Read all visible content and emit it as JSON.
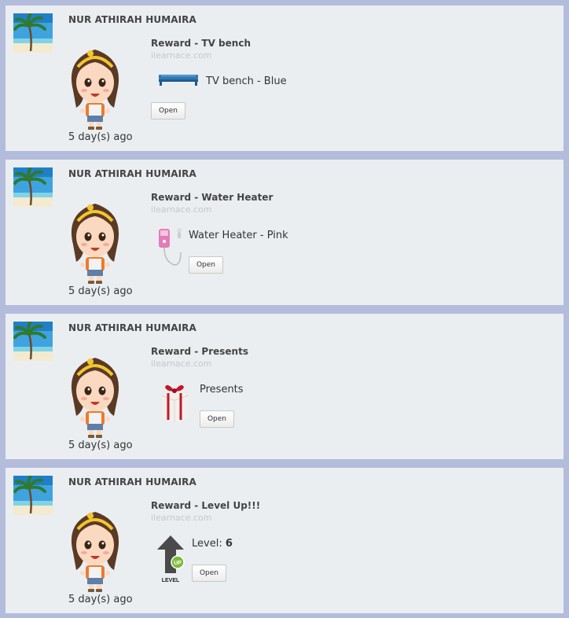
{
  "feed": [
    {
      "user_name": "NUR ATHIRAH HUMAIRA",
      "reward_title": "Reward - TV bench",
      "site": "ilearnace.com",
      "item_label": "TV bench - Blue",
      "item_icon": "tv-bench-icon",
      "open_label": "Open",
      "time_ago": "5 day(s) ago"
    },
    {
      "user_name": "NUR ATHIRAH HUMAIRA",
      "reward_title": "Reward - Water Heater",
      "site": "ilearnace.com",
      "item_label": "Water Heater - Pink",
      "item_icon": "water-heater-icon",
      "open_label": "Open",
      "time_ago": "5 day(s) ago"
    },
    {
      "user_name": "NUR ATHIRAH HUMAIRA",
      "reward_title": "Reward - Presents",
      "site": "ilearnace.com",
      "item_label": "Presents",
      "item_icon": "gift-box-icon",
      "open_label": "Open",
      "time_ago": "5 day(s) ago"
    },
    {
      "user_name": "NUR ATHIRAH HUMAIRA",
      "reward_title": "Reward - Level Up!!!",
      "site": "ilearnace.com",
      "item_label_prefix": "Level:",
      "item_label_value": "6",
      "item_icon": "level-up-icon",
      "level_icon_text": "LEVEL",
      "level_badge_text": "UP",
      "open_label": "Open",
      "time_ago": "5 day(s) ago"
    }
  ],
  "colors": {
    "page_background": "#b4bcdc",
    "card_background": "#eaeef1",
    "site_text": "#c4c8cc"
  }
}
